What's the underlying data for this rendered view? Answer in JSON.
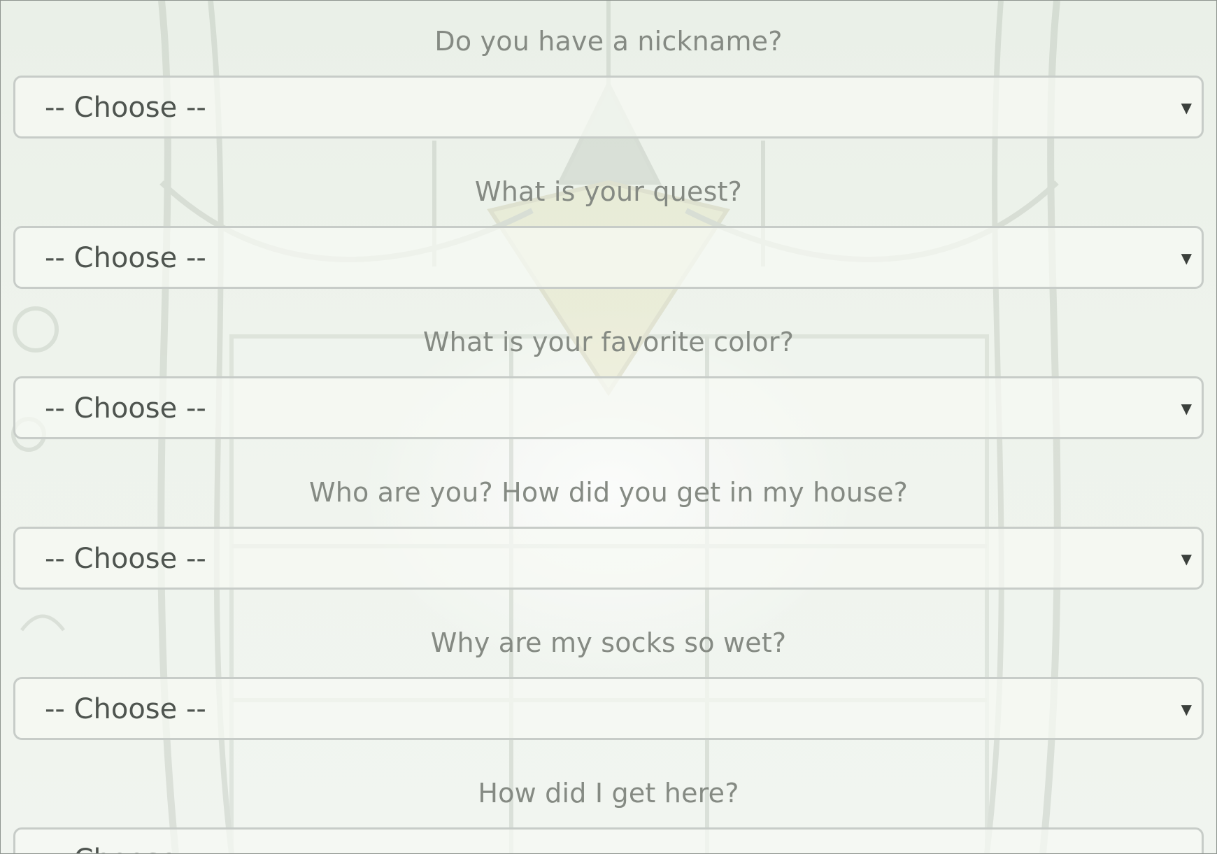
{
  "form": {
    "questions": [
      {
        "label": "Do you have a nickname?",
        "selected": "-- Choose --"
      },
      {
        "label": "What is your quest?",
        "selected": "-- Choose --"
      },
      {
        "label": "What is your favorite color?",
        "selected": "-- Choose --"
      },
      {
        "label": "Who are you? How did you get in my house?",
        "selected": "-- Choose --"
      },
      {
        "label": "Why are my socks so wet?",
        "selected": "-- Choose --"
      },
      {
        "label": "How did I get here?",
        "selected": "-- Choose --"
      }
    ],
    "dropdown_icon": "dropdown-arrow-icon"
  },
  "colors": {
    "label_text": "#858a83",
    "select_text": "#4e544f",
    "select_border": "#c7ccc8",
    "background": "#eef2ec"
  }
}
